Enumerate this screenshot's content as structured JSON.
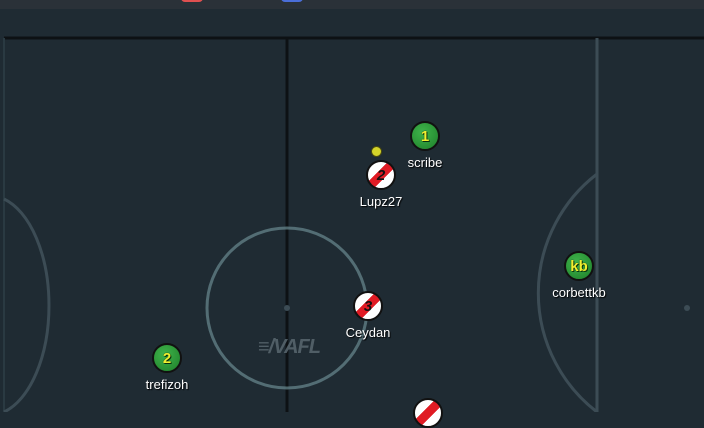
{
  "colors": {
    "field": "#1f2b33",
    "topbar": "#2a3138",
    "line_dark": "#0d1114",
    "line_light": "#3c4c55",
    "center_circle": "#6a8a90",
    "team_green": "#2a9a36",
    "team_red": "#e01b24",
    "avatar_text_green": "#f0f030",
    "ball": "#d4d42a",
    "tab_red": "#e05050",
    "tab_blue": "#4a6ed8"
  },
  "logo": {
    "text": "HAXBALL-logo",
    "icon": "stadium-logo-icon"
  },
  "players": [
    {
      "id": "scribe",
      "team": "green",
      "avatar": "1",
      "name": "scribe"
    },
    {
      "id": "lupz27",
      "team": "red",
      "avatar": "2",
      "name": "Lupz27"
    },
    {
      "id": "corbettkb",
      "team": "green",
      "avatar": "kb",
      "name": "corbettkb"
    },
    {
      "id": "ceydan",
      "team": "red",
      "avatar": "3",
      "name": "Ceydan"
    },
    {
      "id": "trefizoh",
      "team": "green",
      "avatar": "2",
      "name": "trefizoh"
    },
    {
      "id": "offscreen-red",
      "team": "red",
      "avatar": "",
      "name": ""
    }
  ],
  "ball": {
    "icon": "ball-icon"
  }
}
